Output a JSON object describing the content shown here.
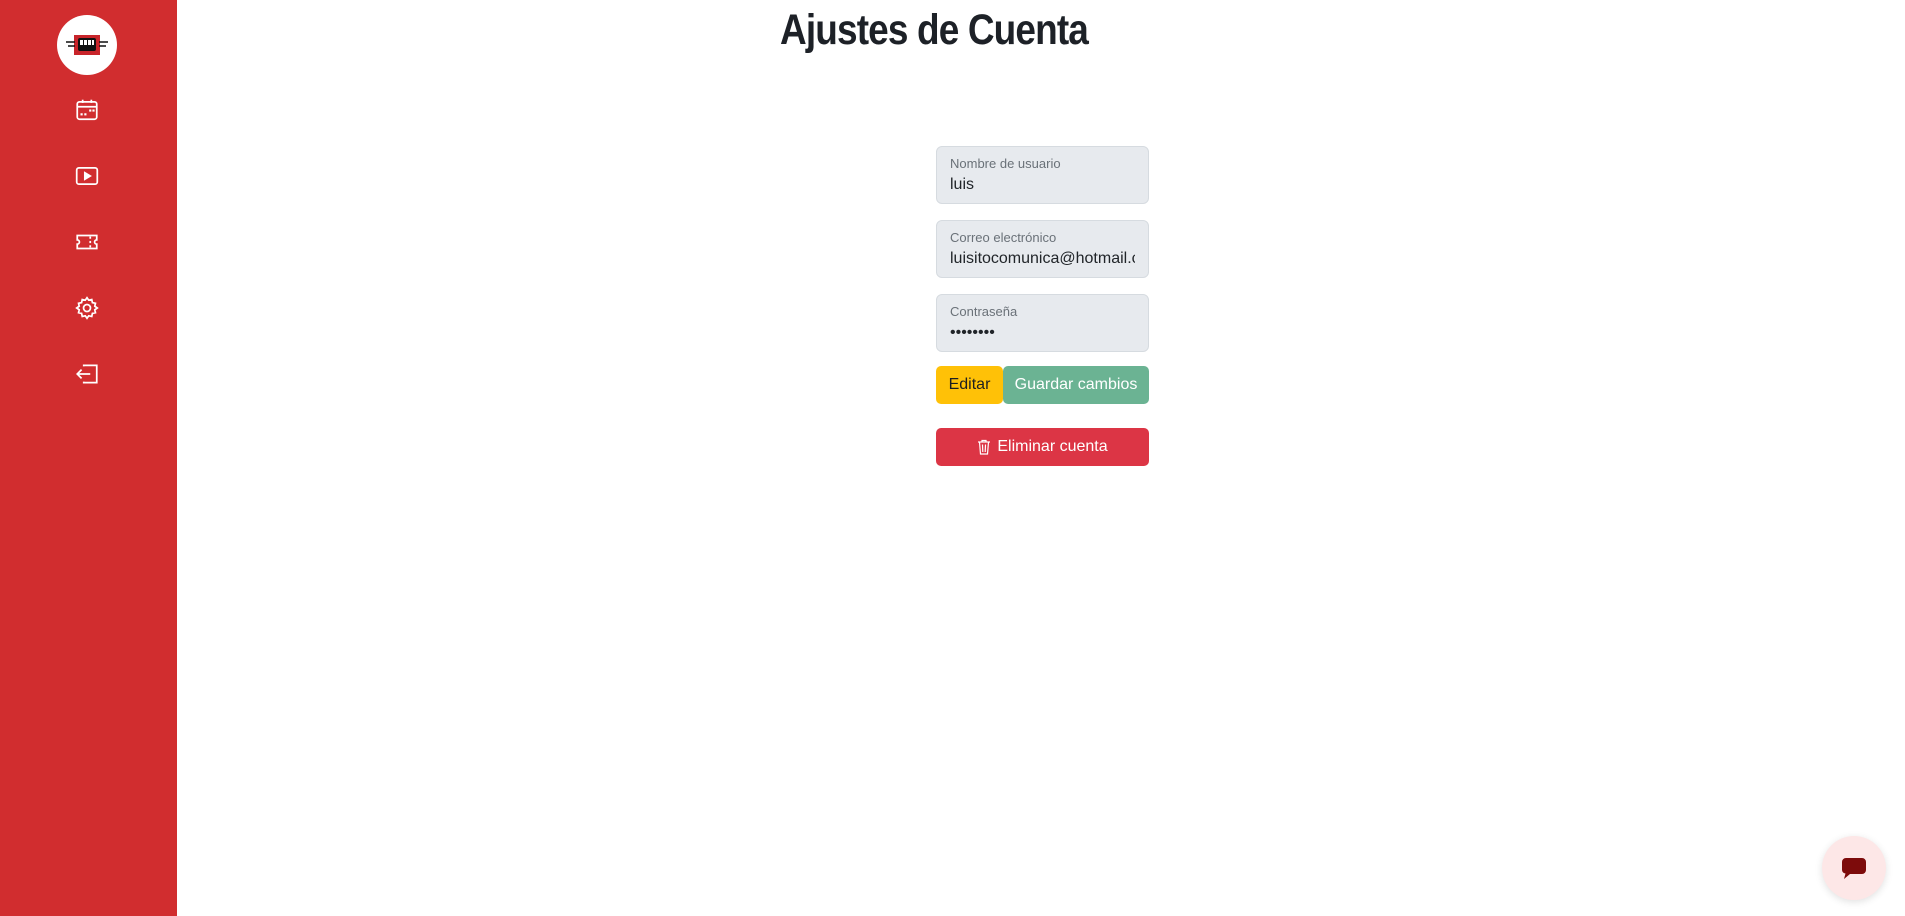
{
  "page": {
    "title": "Ajustes de Cuenta"
  },
  "sidebar": {
    "accent_color": "#d12d2f",
    "logo_icon": "fist-logo-icon",
    "items": [
      {
        "icon": "calendar-icon"
      },
      {
        "icon": "play-icon"
      },
      {
        "icon": "ticket-icon"
      },
      {
        "icon": "gear-icon"
      },
      {
        "icon": "logout-icon"
      }
    ]
  },
  "form": {
    "username": {
      "label": "Nombre de usuario",
      "value": "luis"
    },
    "email": {
      "label": "Correo electrónico",
      "value": "luisitocomunica@hotmail.com"
    },
    "password": {
      "label": "Contraseña",
      "value": "••••••••"
    }
  },
  "buttons": {
    "edit": "Editar",
    "save": "Guardar cambios",
    "delete": "Eliminar cuenta",
    "edit_color": "#ffc107",
    "save_color": "#6bb393",
    "delete_color": "#dc3545"
  },
  "chat": {
    "icon": "chat-icon"
  }
}
